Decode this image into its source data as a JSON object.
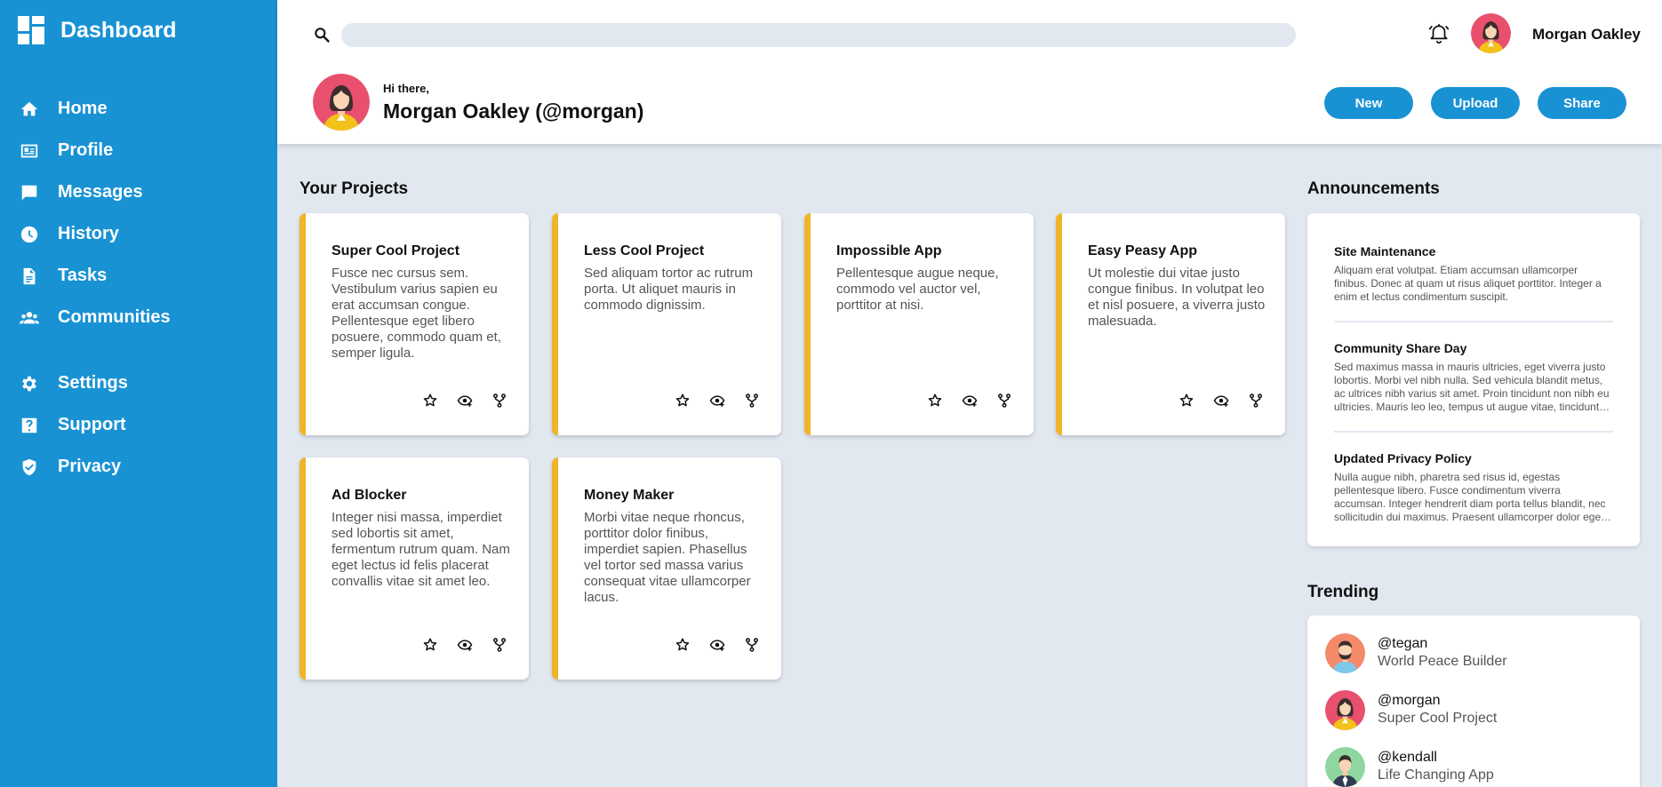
{
  "sidebar": {
    "brand": "Dashboard",
    "items": [
      {
        "label": "Home",
        "icon": "home-icon"
      },
      {
        "label": "Profile",
        "icon": "id-card-icon"
      },
      {
        "label": "Messages",
        "icon": "message-icon"
      },
      {
        "label": "History",
        "icon": "clock-icon"
      },
      {
        "label": "Tasks",
        "icon": "document-icon"
      },
      {
        "label": "Communities",
        "icon": "people-icon"
      },
      {
        "label": "Settings",
        "icon": "gear-icon"
      },
      {
        "label": "Support",
        "icon": "help-icon"
      },
      {
        "label": "Privacy",
        "icon": "shield-icon"
      }
    ]
  },
  "header": {
    "search_placeholder": "",
    "user_name": "Morgan Oakley",
    "greeting": "Hi there,",
    "profile_name": "Morgan Oakley (@morgan)",
    "buttons": {
      "new": "New",
      "upload": "Upload",
      "share": "Share"
    }
  },
  "projects": {
    "title": "Your Projects",
    "items": [
      {
        "title": "Super Cool Project",
        "desc": "Fusce nec cursus sem. Vestibulum varius sapien eu erat accumsan congue. Pellentesque eget libero posuere, commodo quam et, semper ligula."
      },
      {
        "title": "Less Cool Project",
        "desc": "Sed aliquam tortor ac rutrum porta. Ut aliquet mauris in commodo dignissim."
      },
      {
        "title": "Impossible App",
        "desc": "Pellentesque augue neque, commodo vel auctor vel, porttitor at nisi."
      },
      {
        "title": "Easy Peasy App",
        "desc": "Ut molestie dui vitae justo congue finibus. In volutpat leo et nisl posuere, a viverra justo malesuada."
      },
      {
        "title": "Ad Blocker",
        "desc": "Integer nisi massa, imperdiet sed lobortis sit amet, fermentum rutrum quam. Nam eget lectus id felis placerat convallis vitae sit amet leo."
      },
      {
        "title": "Money Maker",
        "desc": "Morbi vitae neque rhoncus, porttitor dolor finibus, imperdiet sapien. Phasellus vel tortor sed massa varius consequat vitae ullamcorper lacus."
      }
    ]
  },
  "announcements": {
    "title": "Announcements",
    "items": [
      {
        "title": "Site Maintenance",
        "body": "Aliquam erat volutpat. Etiam accumsan ullamcorper finibus. Donec at quam ut risus aliquet porttitor. Integer a enim et lectus condimentum suscipit."
      },
      {
        "title": "Community Share Day",
        "body": "Sed maximus massa in mauris ultricies, eget viverra justo lobortis. Morbi vel nibh nulla. Sed vehicula blandit metus, ac ultrices nibh varius sit amet. Proin tincidunt non nibh eu ultricies. Mauris leo leo, tempus ut augue vitae, tincidunt placerat erat."
      },
      {
        "title": "Updated Privacy Policy",
        "body": "Nulla augue nibh, pharetra sed risus id, egestas pellentesque libero. Fusce condimentum viverra accumsan. Integer hendrerit diam porta tellus blandit, nec sollicitudin dui maximus. Praesent ullamcorper dolor eget nunc sollicitudin."
      }
    ]
  },
  "trending": {
    "title": "Trending",
    "items": [
      {
        "handle": "@tegan",
        "project": "World Peace Builder"
      },
      {
        "handle": "@morgan",
        "project": "Super Cool Project"
      },
      {
        "handle": "@kendall",
        "project": "Life Changing App"
      }
    ]
  },
  "colors": {
    "sidebar": "#1992d4",
    "accent": "#f0b429",
    "background": "#e2e8f0"
  }
}
